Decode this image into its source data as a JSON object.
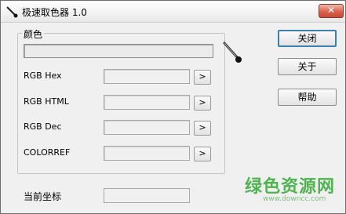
{
  "window": {
    "title": "极速取色器 1.0",
    "close_glyph": "✕"
  },
  "group": {
    "label": "颜色"
  },
  "rows": [
    {
      "label": "RGB Hex",
      "value": "",
      "button": ">"
    },
    {
      "label": "RGB HTML",
      "value": "",
      "button": ">"
    },
    {
      "label": "RGB Dec",
      "value": "",
      "button": ">"
    },
    {
      "label": "COLORREF",
      "value": "",
      "button": ">"
    }
  ],
  "buttons": {
    "close": "关闭",
    "about": "关于",
    "help": "帮助"
  },
  "coords": {
    "label": "当前坐标",
    "value": ""
  },
  "watermark": {
    "text": "绿色资源网",
    "url": "www.downcc.com"
  },
  "colors": {
    "accent": "#3c7fb1",
    "close_button": "#c84a36",
    "watermark": "#4fb34f"
  }
}
